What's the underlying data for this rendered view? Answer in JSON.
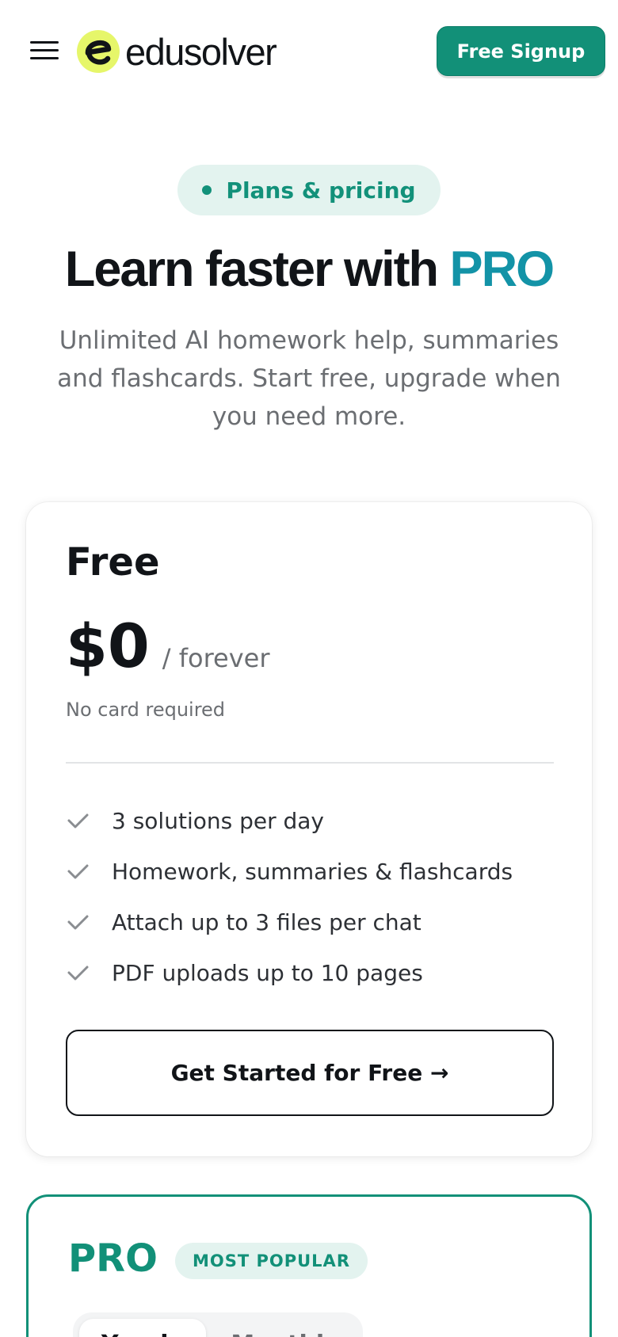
{
  "header": {
    "brand_name": "edusolver",
    "logo_letter": "e",
    "signup_label": "Free Signup",
    "menu_icon": "hamburger-menu-icon"
  },
  "hero": {
    "badge": "Plans & pricing",
    "title_prefix": "Learn faster with",
    "title_highlight": "PRO",
    "subtitle": "Unlimited AI homework help, summaries and flashcards. Start free, upgrade when you need more."
  },
  "plans": {
    "free": {
      "name": "Free",
      "price": "$0",
      "period": "/ forever",
      "note": "No card required",
      "features": [
        "3 solutions per day",
        "Homework, summaries & flashcards",
        "Attach up to 3 files per chat",
        "PDF uploads up to 10 pages"
      ],
      "cta": "Get Started for Free →"
    },
    "pro": {
      "name": "PRO",
      "badge": "MOST POPULAR",
      "billing_options": [
        "Yearly",
        "Monthly"
      ],
      "selected_billing": "Yearly"
    }
  },
  "colors": {
    "brand_green": "#129078",
    "brand_teal": "#1393a7",
    "logo_yellow": "#e6f66a",
    "badge_bg": "#e3f3ef",
    "text_dark": "#111418",
    "text_muted": "#6b6e72"
  }
}
